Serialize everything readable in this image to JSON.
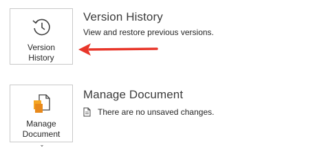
{
  "version_history": {
    "button_label_line1": "Version",
    "button_label_line2": "History",
    "heading": "Version History",
    "description": "View and restore previous versions.",
    "icon": "history-clock-icon"
  },
  "manage_document": {
    "button_label_line1": "Manage",
    "button_label_line2": "Document",
    "dropdown_glyph": "⌄",
    "heading": "Manage Document",
    "status_text": "There are no unsaved changes.",
    "icon": "manage-document-icon",
    "status_icon": "document-icon"
  },
  "annotation": {
    "arrow_color": "#e8362a"
  }
}
